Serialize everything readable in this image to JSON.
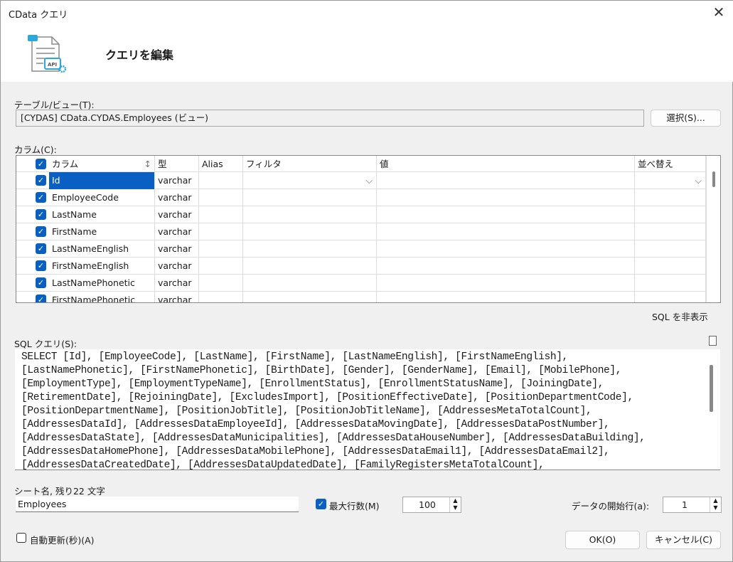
{
  "window": {
    "title": "CData クエリ",
    "close": "✕"
  },
  "header": {
    "title": "クエリを編集",
    "icon": "api-document-icon"
  },
  "table_view": {
    "label": "テーブル/ビュー(T):",
    "value": "[CYDAS] CData.CYDAS.Employees (ビュー)",
    "select_button": "選択(S)..."
  },
  "columns": {
    "label": "カラム(C):",
    "headers": {
      "column": "カラム",
      "type": "型",
      "alias": "Alias",
      "filter": "フィルタ",
      "value": "値",
      "sort": "並べ替え"
    },
    "rows": [
      {
        "name": "Id",
        "type": "varchar"
      },
      {
        "name": "EmployeeCode",
        "type": "varchar"
      },
      {
        "name": "LastName",
        "type": "varchar"
      },
      {
        "name": "FirstName",
        "type": "varchar"
      },
      {
        "name": "LastNameEnglish",
        "type": "varchar"
      },
      {
        "name": "FirstNameEnglish",
        "type": "varchar"
      },
      {
        "name": "LastNamePhonetic",
        "type": "varchar"
      },
      {
        "name": "FirstNamePhonetic",
        "type": "varchar"
      }
    ]
  },
  "hide_sql": "SQL を非表示",
  "sql": {
    "label": "SQL クエリ(S):",
    "lines": [
      "SELECT [Id], [EmployeeCode], [LastName], [FirstName], [LastNameEnglish], [FirstNameEnglish],",
      "[LastNamePhonetic], [FirstNamePhonetic], [BirthDate], [Gender], [GenderName], [Email], [MobilePhone],",
      "[EmploymentType], [EmploymentTypeName], [EnrollmentStatus], [EnrollmentStatusName], [JoiningDate],",
      "[RetirementDate], [RejoiningDate], [ExcludesImport], [PositionEffectiveDate], [PositionDepartmentCode],",
      "[PositionDepartmentName], [PositionJobTitle], [PositionJobTitleName], [AddressesMetaTotalCount],",
      "[AddressesDataId], [AddressesDataEmployeeId], [AddressesDataMovingDate], [AddressesDataPostNumber],",
      "[AddressesDataState], [AddressesDataMunicipalities], [AddressesDataHouseNumber], [AddressesDataBuilding],",
      "[AddressesDataHomePhone], [AddressesDataMobilePhone], [AddressesDataEmail1], [AddressesDataEmail2],",
      "[AddressesDataCreatedDate], [AddressesDataUpdatedDate], [FamilyRegistersMetaTotalCount],"
    ]
  },
  "sheet": {
    "label": "シート名, 残り22 文字",
    "value": "Employees"
  },
  "max_rows": {
    "label": "最大行数(M)",
    "checked": true,
    "value": "100"
  },
  "start_row": {
    "label": "データの開始行(a):",
    "value": "1"
  },
  "auto_refresh": {
    "label": "自動更新(秒)(A)",
    "checked": false
  },
  "buttons": {
    "ok": "OK(O)",
    "cancel": "キャンセル(C)"
  }
}
